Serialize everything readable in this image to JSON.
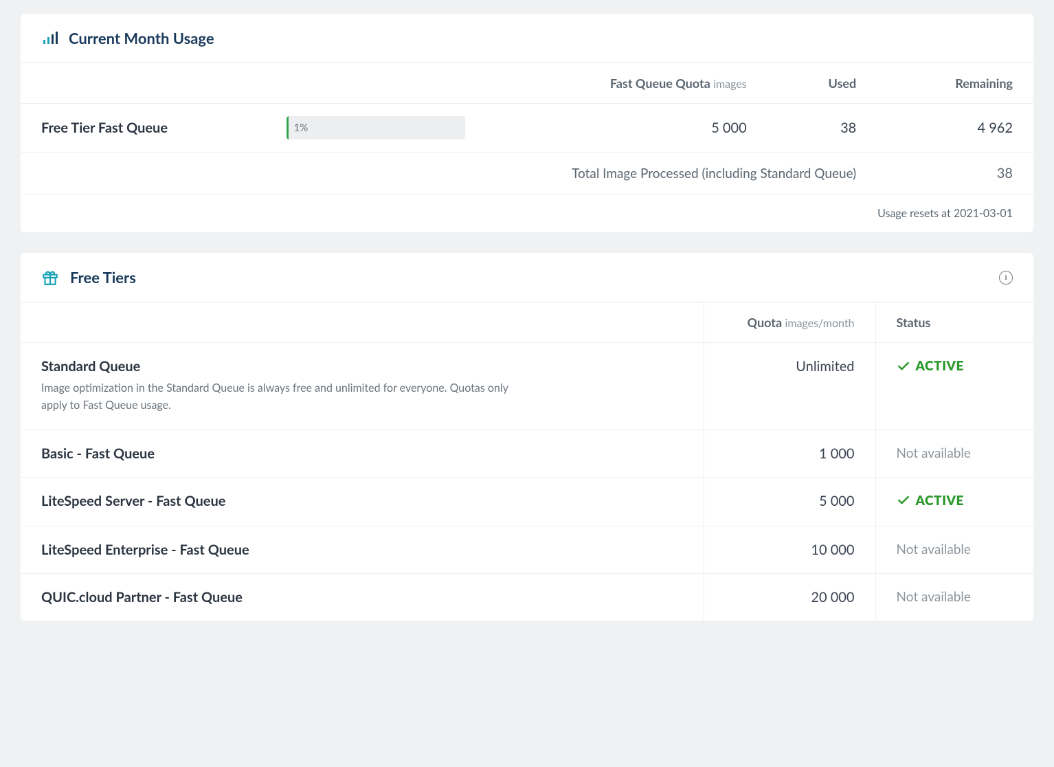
{
  "usage": {
    "title": "Current Month Usage",
    "headers": {
      "quota_label": "Fast Queue Quota",
      "quota_sub": "images",
      "used": "Used",
      "remaining": "Remaining"
    },
    "row": {
      "label": "Free Tier Fast Queue",
      "percent": "1%",
      "quota": "5 000",
      "used": "38",
      "remaining": "4 962"
    },
    "total_label": "Total Image Processed (including Standard Queue)",
    "total_value": "38",
    "reset_note": "Usage resets at 2021-03-01"
  },
  "tiers": {
    "title": "Free Tiers",
    "headers": {
      "quota_label": "Quota",
      "quota_sub": "images/month",
      "status": "Status"
    },
    "status_active": "ACTIVE",
    "status_na": "Not available",
    "rows": [
      {
        "name": "Standard Queue",
        "desc": "Image optimization in the Standard Queue is always free and unlimited for everyone. Quotas only apply to Fast Queue usage.",
        "quota": "Unlimited",
        "status": "active"
      },
      {
        "name": "Basic - Fast Queue",
        "quota": "1 000",
        "status": "na"
      },
      {
        "name": "LiteSpeed Server - Fast Queue",
        "quota": "5 000",
        "status": "active"
      },
      {
        "name": "LiteSpeed Enterprise - Fast Queue",
        "quota": "10 000",
        "status": "na"
      },
      {
        "name": "QUIC.cloud Partner - Fast Queue",
        "quota": "20 000",
        "status": "na"
      }
    ]
  }
}
